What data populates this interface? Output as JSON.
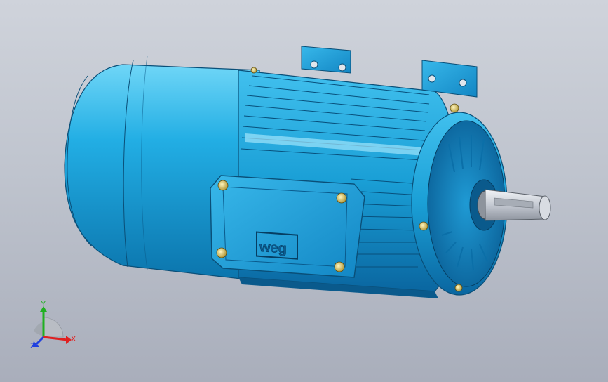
{
  "model": {
    "logo_text": "weg",
    "body_color": "#1aa9e0",
    "body_dark": "#0a6fa8",
    "body_light": "#5fd0f5",
    "shaft_color": "#c9ced6"
  },
  "triad": {
    "x_label": "X",
    "y_label": "Y",
    "z_label": "Z",
    "x_color": "#e02020",
    "y_color": "#20b020",
    "z_color": "#2040e0"
  }
}
